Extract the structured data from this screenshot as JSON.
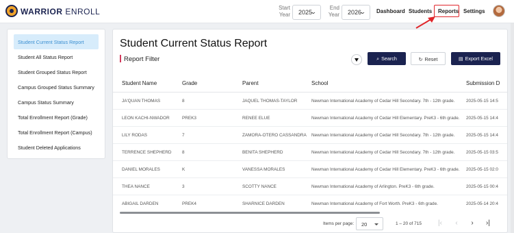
{
  "app": {
    "brand_bold": "WARRIOR",
    "brand_rest": " ENROLL"
  },
  "header": {
    "start_year_label_1": "Start",
    "start_year_label_2": "Year",
    "start_year": "2025",
    "end_year_label_1": "End",
    "end_year_label_2": "Year",
    "end_year": "2026",
    "nav": [
      "Dashboard",
      "Students",
      "Reports",
      "Settings"
    ],
    "active_nav": "Reports"
  },
  "sidebar": {
    "items": [
      {
        "label": "Student Current Status Report",
        "active": true
      },
      {
        "label": "Student All Status Report",
        "active": false
      },
      {
        "label": "Student Grouped Status Report",
        "active": false
      },
      {
        "label": "Campus Grouped Status Summary",
        "active": false
      },
      {
        "label": "Campus Status Summary",
        "active": false
      },
      {
        "label": "Total Enrollment Report (Grade)",
        "active": false
      },
      {
        "label": "Total Enrollment Report (Campus)",
        "active": false
      },
      {
        "label": "Student Deleted Applications",
        "active": false
      }
    ]
  },
  "main": {
    "title": "Student Current Status Report",
    "filter_title": "Report Filter",
    "buttons": {
      "search": "Search",
      "reset": "Reset",
      "export": "Export Excel"
    },
    "columns": [
      "Student Name",
      "Grade",
      "Parent",
      "School",
      "Submission D"
    ],
    "rows": [
      [
        "JA'QUAN THOMAS",
        "8",
        "JAQUEL THOMAS-TAYLOR",
        "Newman International Academy of Cedar Hill Secondary. 7th - 12th grade.",
        "2025-05-15 14:5"
      ],
      [
        "LEON KACHI-NWADOR",
        "PREK3",
        "RENEE ELUE",
        "Newman International Academy of Cedar Hill Elementary. PreK3 - 6th grade.",
        "2025-05-15 14:4"
      ],
      [
        "LILY RODAS",
        "7",
        "ZAMORA-OTERO CASSANDRA",
        "Newman International Academy of Cedar Hill Secondary. 7th - 12th grade.",
        "2025-05-15 14:4"
      ],
      [
        "TERRENCE SHEPHERD",
        "8",
        "BENITA SHEPHERD",
        "Newman International Academy of Cedar Hill Secondary. 7th - 12th grade.",
        "2025-05-15 03:5"
      ],
      [
        "DANIEL MORALES",
        "K",
        "VANESSA MORALES",
        "Newman International Academy of Cedar Hill Elementary. PreK3 - 6th grade.",
        "2025-05-15 02:0"
      ],
      [
        "THEA NANCE",
        "3",
        "SCOTTY NANCE",
        "Newman International Academy of Arlington. PreK3 - 6th grade.",
        "2025-05-15 00:4"
      ],
      [
        "ABIGAIL DARDEN",
        "PREK4",
        "SHARNICE DARDEN",
        "Newman International Academy of Fort Worth. PreK3 - 6th grade.",
        "2025-05-14 20:4"
      ]
    ]
  },
  "pagination": {
    "items_per_page_label": "Items per page:",
    "items_per_page": "20",
    "range": "1 – 20 of 715"
  },
  "colors": {
    "brand": "#1b2350",
    "accent": "#d23a5c",
    "highlight": "#e0262b",
    "active_bg": "#d7ecfb"
  },
  "icons": [
    "logo-icon",
    "chevron-down-icon",
    "avatar",
    "filter-icon",
    "search-icon",
    "refresh-icon",
    "excel-icon",
    "first-page-icon",
    "prev-page-icon",
    "next-page-icon",
    "last-page-icon"
  ]
}
